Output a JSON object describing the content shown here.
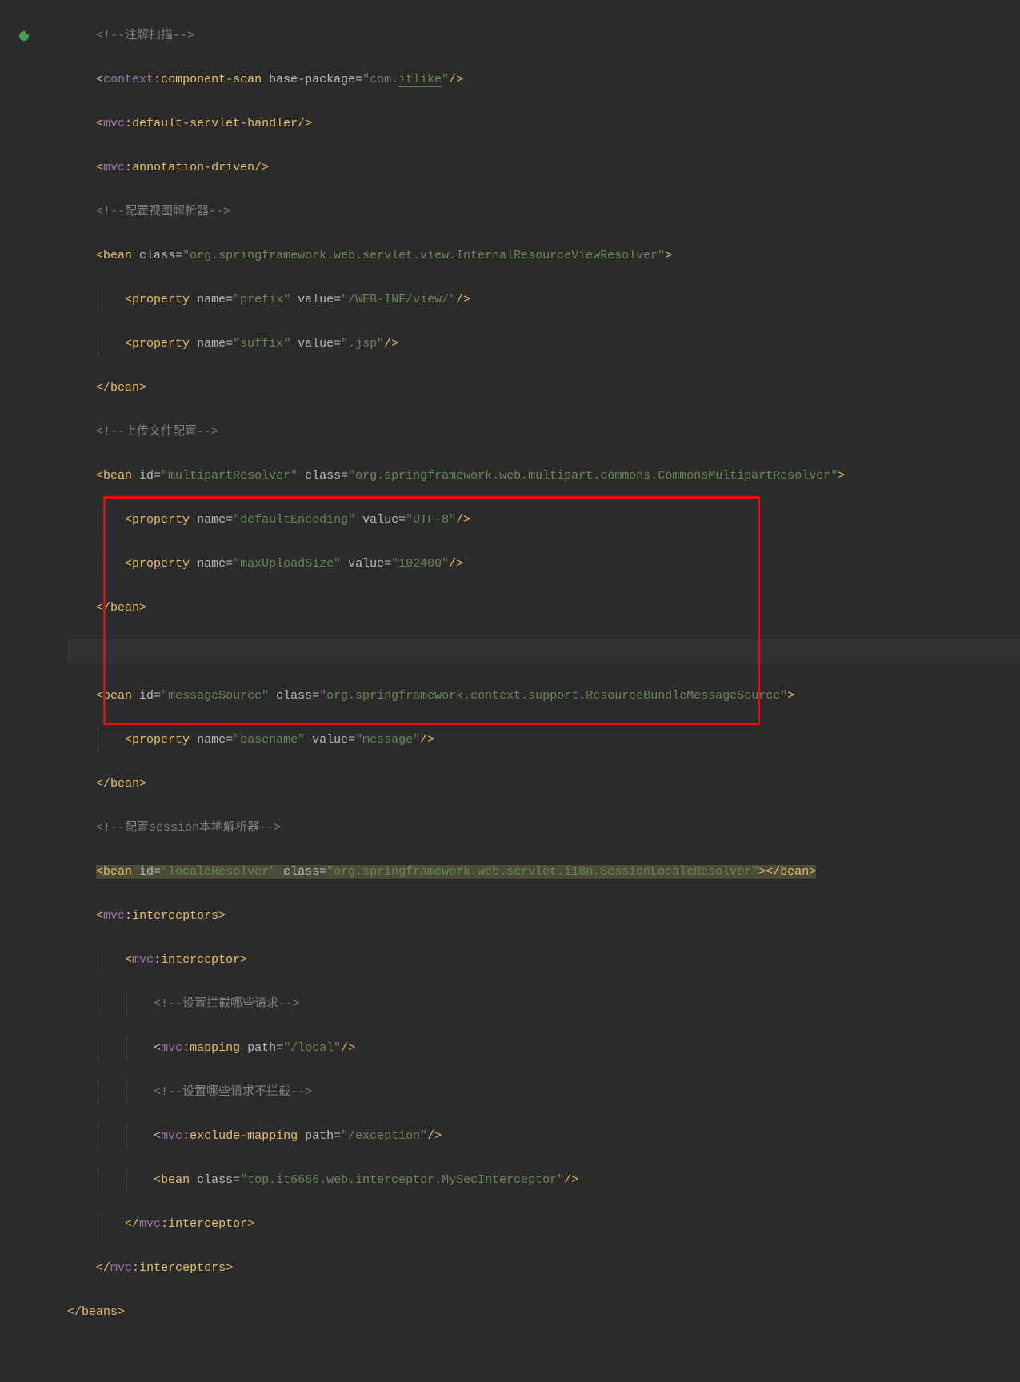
{
  "gutter": {
    "icon_name": "spring-bean-icon"
  },
  "code": {
    "l1_comment": "<!--注解扫描-->",
    "l2_open": "<",
    "l2_ns": "context",
    "l2_colon": ":",
    "l2_tag": "component-scan",
    "l2_attr": " base-package",
    "l2_eq": "=",
    "l2_str": "\"com.",
    "l2_str_underline": "itlike",
    "l2_str_end": "\"",
    "l2_close": "/>",
    "l3_open": "<",
    "l3_ns": "mvc",
    "l3_colon": ":",
    "l3_tag": "default-servlet-handler",
    "l3_close": "/>",
    "l4_open": "<",
    "l4_ns": "mvc",
    "l4_colon": ":",
    "l4_tag": "annotation-driven",
    "l4_close": "/>",
    "l5_comment": "<!--配置视图解析器-->",
    "l6_open": "<",
    "l6_tag": "bean",
    "l6_attr": " class",
    "l6_eq": "=",
    "l6_str": "\"org.springframework.web.servlet.view.InternalResourceViewResolver\"",
    "l6_close": ">",
    "l7_open": "<",
    "l7_tag": "property",
    "l7_attr1": " name",
    "l7_eq": "=",
    "l7_str1": "\"prefix\"",
    "l7_attr2": " value",
    "l7_str2": "\"/WEB-INF/view/\"",
    "l7_close": "/>",
    "l8_open": "<",
    "l8_tag": "property",
    "l8_attr1": " name",
    "l8_eq": "=",
    "l8_str1": "\"suffix\"",
    "l8_attr2": " value",
    "l8_str2": "\".jsp\"",
    "l8_close": "/>",
    "l9_open": "</",
    "l9_tag": "bean",
    "l9_close": ">",
    "l10_comment": "<!--上传文件配置-->",
    "l11_open": "<",
    "l11_tag": "bean",
    "l11_attr1": " id",
    "l11_eq": "=",
    "l11_str1": "\"multipartResolver\"",
    "l11_attr2": " class",
    "l11_str2": "\"org.springframework.web.multipart.commons.CommonsMultipartResolver\"",
    "l11_close": ">",
    "l12_open": "<",
    "l12_tag": "property",
    "l12_attr1": " name",
    "l12_eq": "=",
    "l12_str1": "\"defaultEncoding\"",
    "l12_attr2": " value",
    "l12_str2": "\"UTF-8\"",
    "l12_close": "/>",
    "l13_open": "<",
    "l13_tag": "property",
    "l13_attr1": " name",
    "l13_eq": "=",
    "l13_str1": "\"maxUploadSize\"",
    "l13_attr2": " value",
    "l13_str2": "\"102400\"",
    "l13_close": "/>",
    "l14_open": "</",
    "l14_tag": "bean",
    "l14_close": ">",
    "l16_open": "<",
    "l16_tag": "bean",
    "l16_attr1": " id",
    "l16_eq": "=",
    "l16_str1": "\"messageSource\"",
    "l16_attr2": " class",
    "l16_str2": "\"org.springframework.context.support.ResourceBundleMessageSource\"",
    "l16_close": ">",
    "l17_open": "<",
    "l17_tag": "property",
    "l17_attr1": " name",
    "l17_eq": "=",
    "l17_str1": "\"basename\"",
    "l17_attr2": " value",
    "l17_str2": "\"message\"",
    "l17_close": "/>",
    "l18_open": "</",
    "l18_tag": "bean",
    "l18_close": ">",
    "l19_comment": "<!--配置session本地解析器-->",
    "l20_open": "<",
    "l20_tag": "bean",
    "l20_attr1": " id",
    "l20_eq": "=",
    "l20_str1": "\"localeResolver\"",
    "l20_attr2": " class",
    "l20_str2": "\"org.springframework.web.servlet.i18n.SessionLocaleResolver\"",
    "l20_close": ">",
    "l20_endopen": "</",
    "l20_endtag": "bean",
    "l20_endclose": ">",
    "l21_open": "<",
    "l21_ns": "mvc",
    "l21_colon": ":",
    "l21_tag": "interceptors",
    "l21_close": ">",
    "l22_open": "<",
    "l22_ns": "mvc",
    "l22_colon": ":",
    "l22_tag": "interceptor",
    "l22_close": ">",
    "l23_comment": "<!--设置拦截哪些请求-->",
    "l24_open": "<",
    "l24_ns": "mvc",
    "l24_colon": ":",
    "l24_tag": "mapping",
    "l24_attr": " path",
    "l24_eq": "=",
    "l24_str": "\"/local\"",
    "l24_close": "/>",
    "l25_comment": "<!--设置哪些请求不拦截-->",
    "l26_open": "<",
    "l26_ns": "mvc",
    "l26_colon": ":",
    "l26_tag": "exclude-mapping",
    "l26_attr": " path",
    "l26_eq": "=",
    "l26_str": "\"/exception\"",
    "l26_close": "/>",
    "l27_open": "<",
    "l27_tag": "bean",
    "l27_attr": " class",
    "l27_eq": "=",
    "l27_str": "\"top.it6666.web.interceptor.MySecInterceptor\"",
    "l27_close": "/>",
    "l28_open": "</",
    "l28_ns": "mvc",
    "l28_colon": ":",
    "l28_tag": "interceptor",
    "l28_close": ">",
    "l29_open": "</",
    "l29_ns": "mvc",
    "l29_colon": ":",
    "l29_tag": "interceptors",
    "l29_close": ">",
    "l30_open": "</",
    "l30_tag": "beans",
    "l30_close": ">"
  }
}
